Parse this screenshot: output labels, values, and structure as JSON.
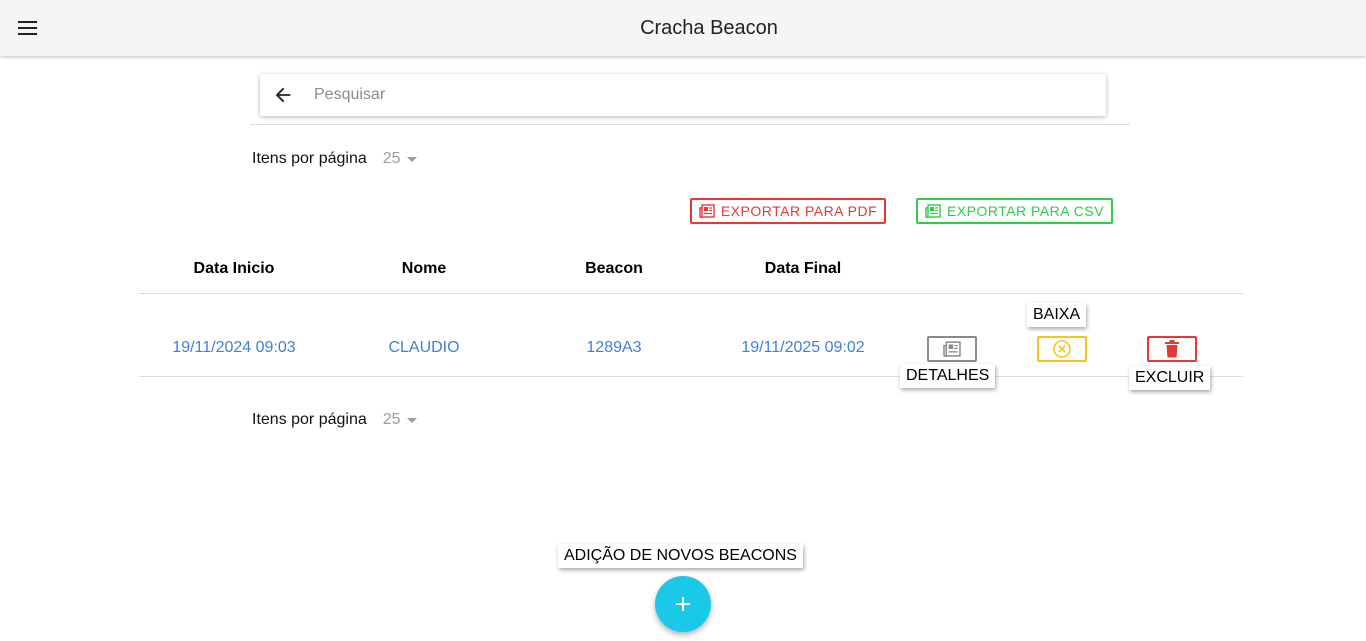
{
  "header": {
    "title": "Cracha Beacon",
    "menu_icon": "menu-icon"
  },
  "search": {
    "placeholder": "Pesquisar",
    "value": "",
    "back_icon": "arrow-left-icon"
  },
  "pager_top": {
    "label": "Itens por página",
    "value": "25"
  },
  "pager_bottom": {
    "label": "Itens por página",
    "value": "25"
  },
  "exports": {
    "pdf_label": "EXPORTAR PARA PDF",
    "csv_label": "EXPORTAR PARA CSV",
    "pdf_color": "#e53935",
    "csv_color": "#2ecc4a"
  },
  "table": {
    "columns": [
      "Data Inicio",
      "Nome",
      "Beacon",
      "Data Final"
    ],
    "rows": [
      {
        "data_inicio": "19/11/2024 09:03",
        "nome": "CLAUDIO",
        "beacon": "1289A3",
        "data_final": "19/11/2025 09:02"
      }
    ]
  },
  "actions": {
    "details_tooltip": "DETALHES",
    "baixa_tooltip": "BAIXA",
    "excluir_tooltip": "EXCLUIR",
    "details_icon": "newspaper-icon",
    "baixa_icon": "cancel-circle-icon",
    "excluir_icon": "trash-icon"
  },
  "fab": {
    "tooltip": "ADIÇÃO DE NOVOS BEACONS",
    "icon": "plus-icon",
    "color": "#1cc8e8"
  }
}
